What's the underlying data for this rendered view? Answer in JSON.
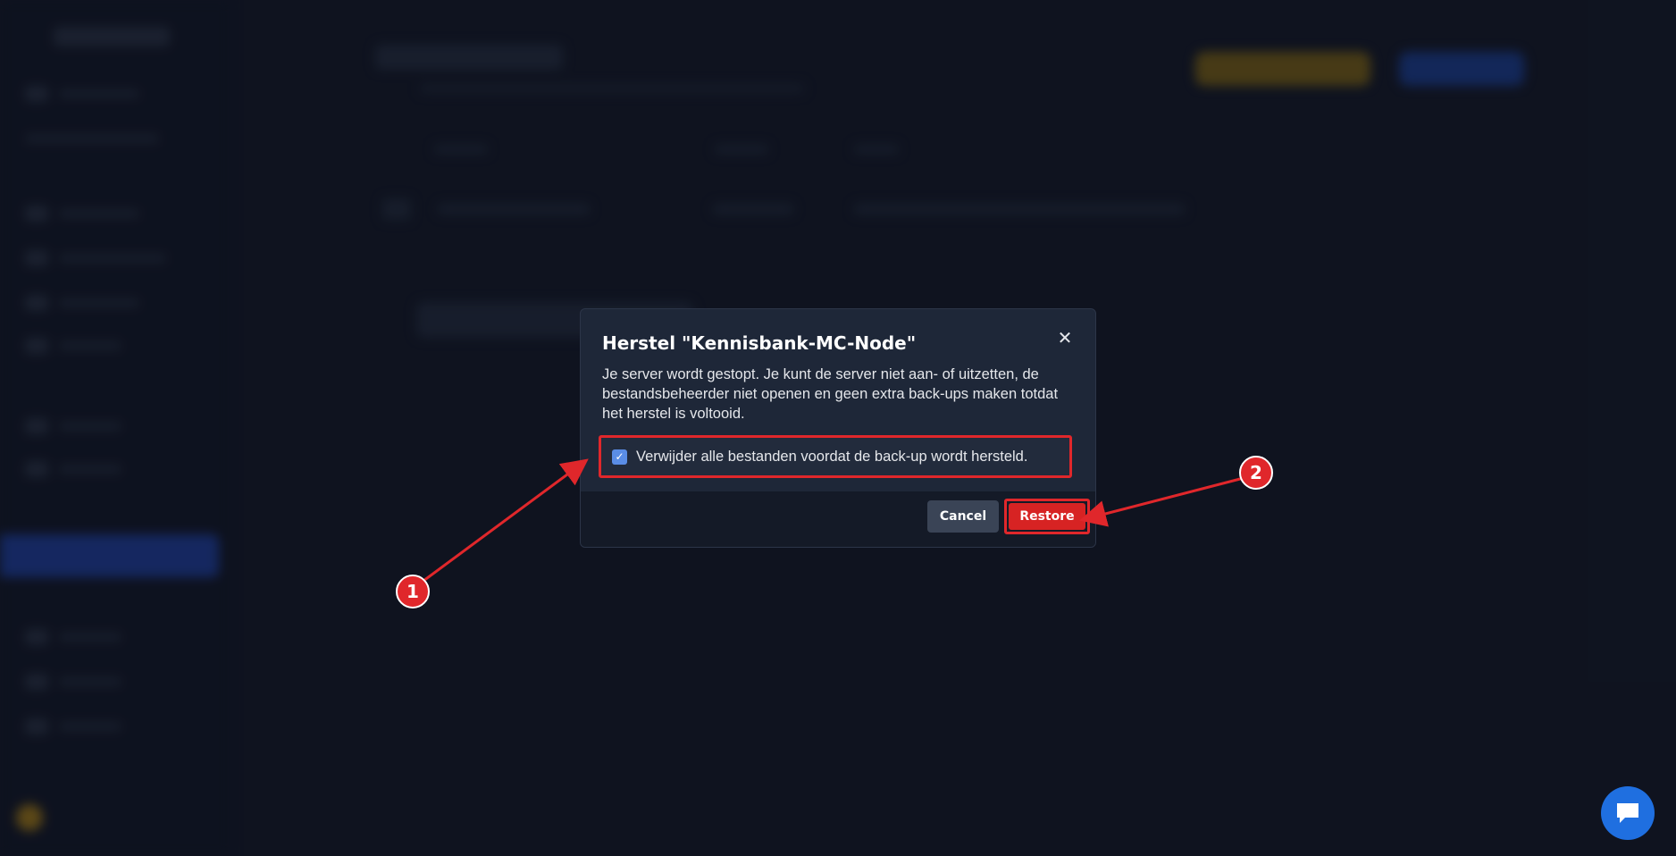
{
  "modal": {
    "title": "Herstel \"Kennisbank-MC-Node\"",
    "close_icon": "close-icon",
    "description": "Je server wordt gestopt. Je kunt de server niet aan- of uitzetten, de bestandsbeheerder niet openen en geen extra back-ups maken totdat het herstel is voltooid.",
    "checkbox": {
      "label": "Verwijder alle bestanden voordat de back-up wordt hersteld.",
      "checked": true
    },
    "buttons": {
      "cancel": "Cancel",
      "restore": "Restore"
    }
  },
  "annotations": {
    "badge_1": "1",
    "badge_2": "2",
    "color": "#e0272b"
  },
  "chat_widget": {
    "icon": "chat-bubble-icon",
    "color": "#1f6fe0"
  }
}
